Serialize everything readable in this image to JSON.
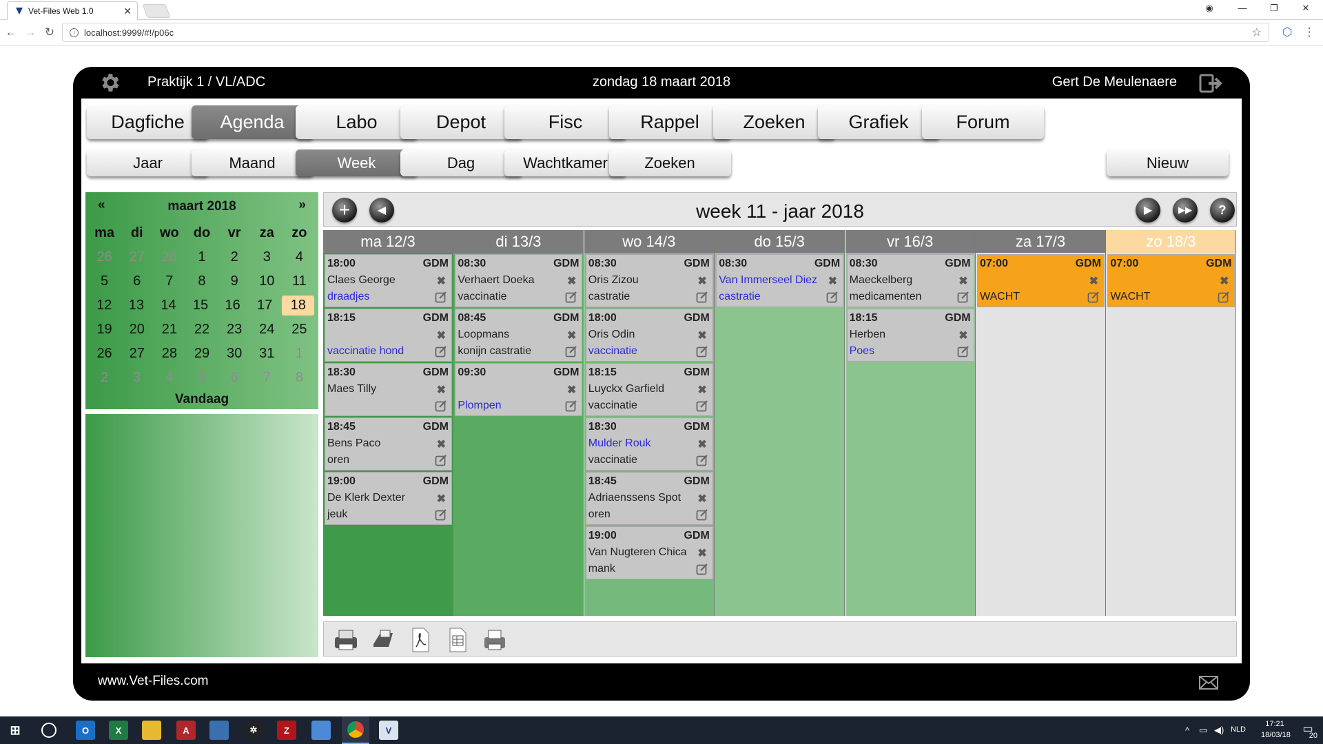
{
  "browser": {
    "tab_title": "Vet-Files Web 1.0",
    "url": "localhost:9999/#!/p06c"
  },
  "header": {
    "practice": "Praktijk 1 / VL/ADC",
    "date": "zondag 18 maart 2018",
    "user": "Gert De Meulenaere"
  },
  "main_menu": [
    "Dagfiche",
    "Agenda",
    "Labo",
    "Depot",
    "Fisc",
    "Rappel",
    "Zoeken",
    "Grafiek",
    "Forum"
  ],
  "main_menu_active": "Agenda",
  "sub_menu": [
    "Jaar",
    "Maand",
    "Week",
    "Dag",
    "Wachtkamer",
    "Zoeken"
  ],
  "sub_menu_active": "Week",
  "sub_menu_new": "Nieuw",
  "minical": {
    "prev": "«",
    "next": "»",
    "title": "maart 2018",
    "weekdays": [
      "ma",
      "di",
      "wo",
      "do",
      "vr",
      "za",
      "zo"
    ],
    "rows": [
      [
        "26",
        "27",
        "28",
        "1",
        "2",
        "3",
        "4"
      ],
      [
        "5",
        "6",
        "7",
        "8",
        "9",
        "10",
        "11"
      ],
      [
        "12",
        "13",
        "14",
        "15",
        "16",
        "17",
        "18"
      ],
      [
        "19",
        "20",
        "21",
        "22",
        "23",
        "24",
        "25"
      ],
      [
        "26",
        "27",
        "28",
        "29",
        "30",
        "31",
        "1"
      ],
      [
        "2",
        "3",
        "4",
        "5",
        "6",
        "7",
        "8"
      ]
    ],
    "today_label": "Vandaag"
  },
  "week": {
    "title": "week 11 - jaar 2018",
    "days": [
      {
        "label": "ma 12/3",
        "appts": [
          {
            "time": "18:00",
            "doc": "GDM",
            "l2": "Claes George",
            "l3": "draadjes",
            "l3blue": true
          },
          {
            "time": "18:15",
            "doc": "GDM",
            "l2": "",
            "l3": "vaccinatie hond",
            "l3blue": true
          },
          {
            "time": "18:30",
            "doc": "GDM",
            "l2": "Maes Tilly",
            "l3": ""
          },
          {
            "time": "18:45",
            "doc": "GDM",
            "l2": "Bens Paco",
            "l3": "oren"
          },
          {
            "time": "19:00",
            "doc": "GDM",
            "l2": "De Klerk Dexter",
            "l3": "jeuk"
          }
        ]
      },
      {
        "label": "di 13/3",
        "appts": [
          {
            "time": "08:30",
            "doc": "GDM",
            "l2": "Verhaert Doeka",
            "l3": "vaccinatie"
          },
          {
            "time": "08:45",
            "doc": "GDM",
            "l2": "Loopmans",
            "l3": "konijn castratie"
          },
          {
            "time": "09:30",
            "doc": "GDM",
            "l2": "",
            "l3": "Plompen",
            "l3blue": true
          }
        ]
      },
      {
        "label": "wo 14/3",
        "appts": [
          {
            "time": "08:30",
            "doc": "GDM",
            "l2": "Oris Zizou",
            "l3": "castratie"
          },
          {
            "time": "18:00",
            "doc": "GDM",
            "l2": "Oris Odin",
            "l3": "vaccinatie",
            "l3blue": true
          },
          {
            "time": "18:15",
            "doc": "GDM",
            "l2": "Luyckx Garfield",
            "l3": "vaccinatie"
          },
          {
            "time": "18:30",
            "doc": "GDM",
            "l2": "Mulder Rouk",
            "l2blue": true,
            "l3": "vaccinatie"
          },
          {
            "time": "18:45",
            "doc": "GDM",
            "l2": "Adriaenssens Spot",
            "l3": "oren"
          },
          {
            "time": "19:00",
            "doc": "GDM",
            "l2": "Van Nugteren Chica",
            "l3": "mank"
          }
        ]
      },
      {
        "label": "do 15/3",
        "appts": [
          {
            "time": "08:30",
            "doc": "GDM",
            "l2": "Van Immerseel Diez",
            "l2blue": true,
            "l3": "castratie",
            "l3blue": true
          }
        ]
      },
      {
        "label": "vr 16/3",
        "appts": [
          {
            "time": "08:30",
            "doc": "GDM",
            "l2": "Maeckelberg",
            "l3": "medicamenten"
          },
          {
            "time": "18:15",
            "doc": "GDM",
            "l2": "Herben",
            "l3": "Poes",
            "l3blue": true
          }
        ]
      },
      {
        "label": "za 17/3",
        "appts": [
          {
            "time": "07:00",
            "doc": "GDM",
            "l2": "",
            "l3": "WACHT",
            "orange": true
          }
        ]
      },
      {
        "label": "zo 18/3",
        "today": true,
        "appts": [
          {
            "time": "07:00",
            "doc": "GDM",
            "l2": "",
            "l3": "WACHT",
            "orange": true
          }
        ]
      }
    ],
    "day_colors": [
      "#3f9a49",
      "#5aaa62",
      "#76b97c",
      "#8cc490",
      "#8cc490",
      "#e3e3e3",
      "#e3e3e3"
    ]
  },
  "toolbar_icons": [
    "printer-icon",
    "receipt-printer-icon",
    "pdf-icon",
    "excel-icon",
    "fax-icon"
  ],
  "footer": {
    "site": "www.Vet-Files.com"
  },
  "taskbar": {
    "lang": "NLD",
    "time": "17:21",
    "date": "18/03/18",
    "notifications": "20"
  }
}
